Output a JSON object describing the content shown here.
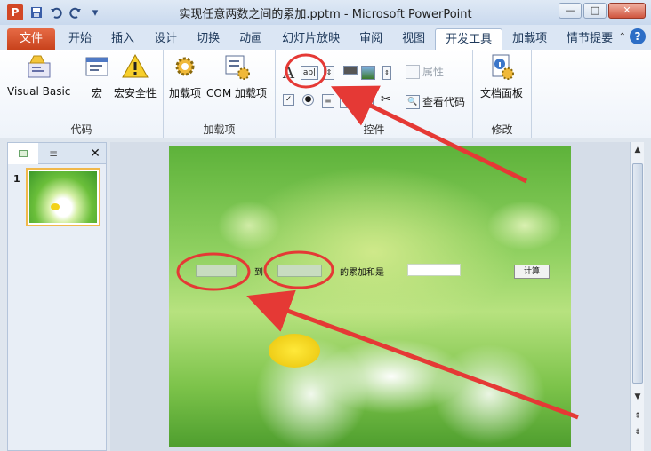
{
  "window": {
    "app_icon": "P",
    "title": "实现任意两数之间的累加.pptm - Microsoft PowerPoint",
    "minimize": "—",
    "maximize": "□",
    "close": "✕"
  },
  "qat": {
    "save_icon": "save-icon",
    "undo_icon": "undo-icon",
    "redo_icon": "redo-icon",
    "customize_icon": "customize-icon"
  },
  "tabs": [
    {
      "label": "文件",
      "state": "file"
    },
    {
      "label": "开始"
    },
    {
      "label": "插入"
    },
    {
      "label": "设计"
    },
    {
      "label": "切换"
    },
    {
      "label": "动画"
    },
    {
      "label": "幻灯片放映"
    },
    {
      "label": "审阅"
    },
    {
      "label": "视图"
    },
    {
      "label": "开发工具",
      "state": "active"
    },
    {
      "label": "加载项"
    },
    {
      "label": "情节提要"
    }
  ],
  "ribbon": {
    "code_group": {
      "label": "代码",
      "visual_basic": "Visual Basic",
      "macros": "宏",
      "macro_security": "宏安全性"
    },
    "addins_group": {
      "label": "加载项",
      "addins": "加载项",
      "com_addins": "COM 加载项"
    },
    "controls_group": {
      "label": "控件",
      "properties": "属性",
      "view_code": "查看代码"
    },
    "modify_group": {
      "label": "修改",
      "document_panel": "文档面板"
    }
  },
  "slides_pane": {
    "slide_number": "1"
  },
  "slide": {
    "to_label": "到",
    "sum_label": "的累加和是",
    "calc_button": "计算"
  },
  "colors": {
    "accent_file_tab": "#d24726",
    "annotation_red": "#e53935",
    "ribbon_bg": "#ffffff"
  }
}
